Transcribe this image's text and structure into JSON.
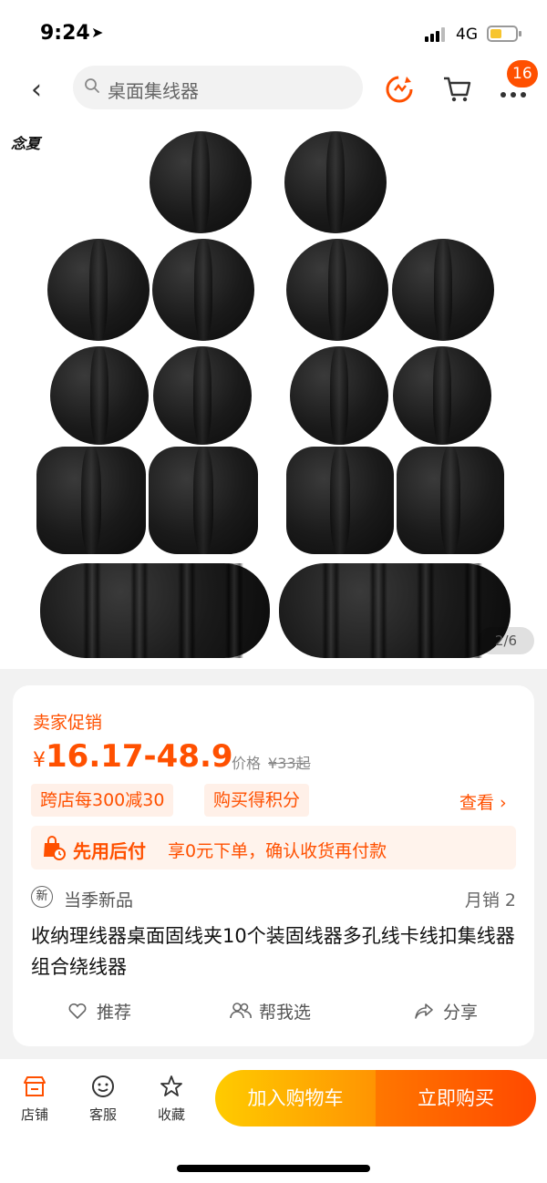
{
  "status_bar": {
    "time": "9:24",
    "network": "4G",
    "battery_level": 0.45
  },
  "nav": {
    "search_placeholder": "桌面集线器",
    "cart_badge": "16"
  },
  "hero": {
    "brand": "念夏",
    "pager": "2/6"
  },
  "promo": {
    "title": "卖家促销",
    "currency": "¥",
    "price": "16.17-48.9",
    "orig_label": "价格",
    "orig_value": "¥33起",
    "tags": [
      "跨店每300减30",
      "购买得积分"
    ],
    "view_more": "查看 ›"
  },
  "pay_later": {
    "title": "先用后付",
    "desc": "享0元下单，确认收货再付款"
  },
  "meta": {
    "new_icon": "新",
    "season": "当季新品",
    "sales": "月销 2"
  },
  "product_title": "收纳理线器桌面固线夹10个装固线器多孔线卡线扣集线器组合绕线器",
  "actions": {
    "recommend": "推荐",
    "help_choose": "帮我选",
    "share": "分享"
  },
  "bottom": {
    "store": "店铺",
    "service": "客服",
    "favorite": "收藏",
    "add_cart": "加入购物车",
    "buy_now": "立即购买"
  },
  "colors": {
    "accent": "#ff5000",
    "cart_button": "#ffa000",
    "buy_button": "#ff5500"
  }
}
